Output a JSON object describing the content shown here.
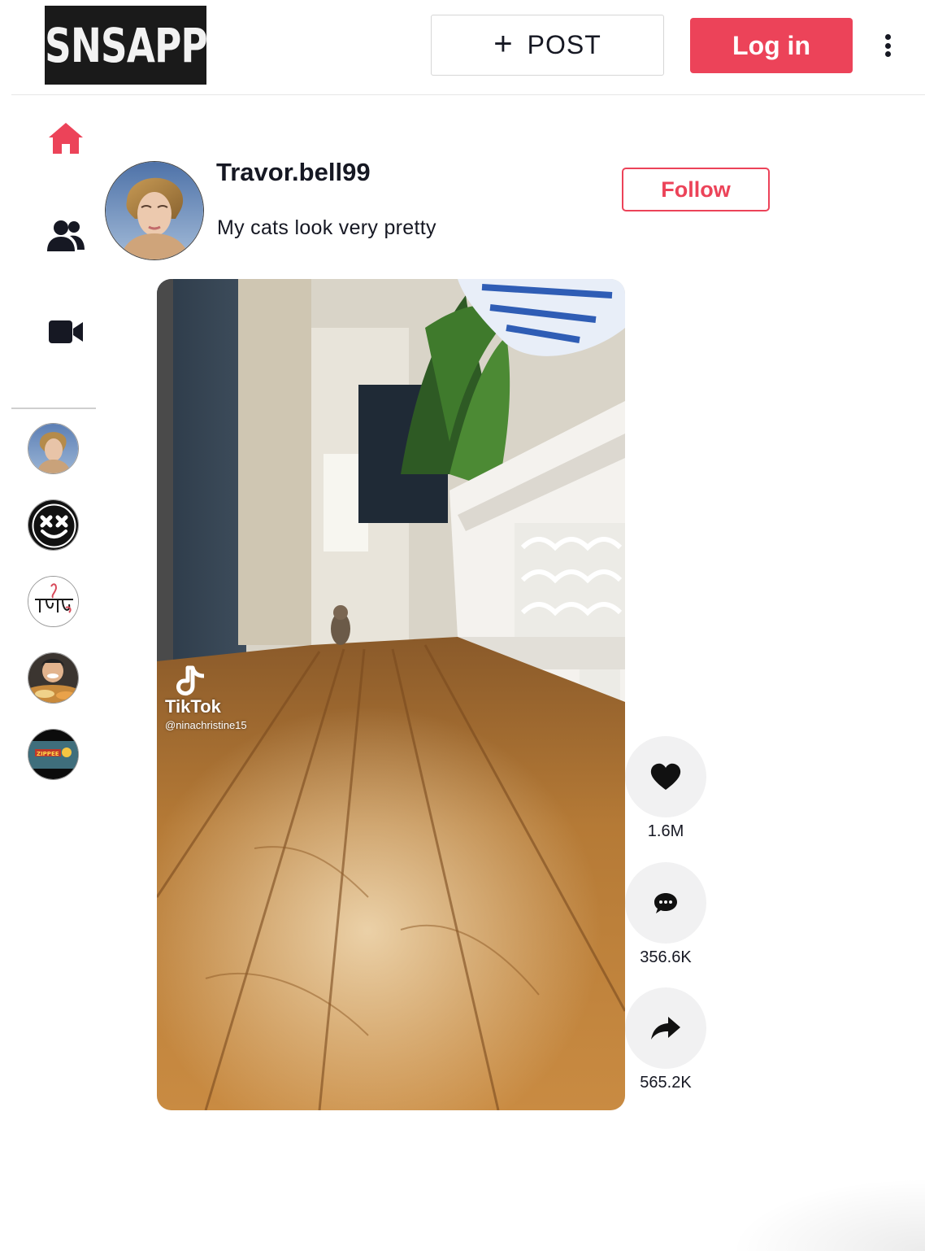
{
  "header": {
    "logo_text": "SNSAPP",
    "post_button_label": "POST",
    "login_button_label": "Log in"
  },
  "sidebar": {
    "nav": [
      {
        "name": "home",
        "icon": "home-icon",
        "active": true
      },
      {
        "name": "following",
        "icon": "users-icon",
        "active": false
      },
      {
        "name": "live",
        "icon": "video-camera-icon",
        "active": false
      }
    ],
    "followed_accounts_count": 5
  },
  "post": {
    "username": "Travor.bell99",
    "caption": "My cats look very pretty",
    "follow_label": "Follow",
    "video_watermark": {
      "brand": "TikTok",
      "handle": "@ninachristine15"
    },
    "actions": {
      "likes": "1.6M",
      "comments": "356.6K",
      "shares": "565.2K"
    }
  },
  "colors": {
    "accent": "#ec4359",
    "text": "#161823",
    "action_bg": "#f1f1f2"
  }
}
